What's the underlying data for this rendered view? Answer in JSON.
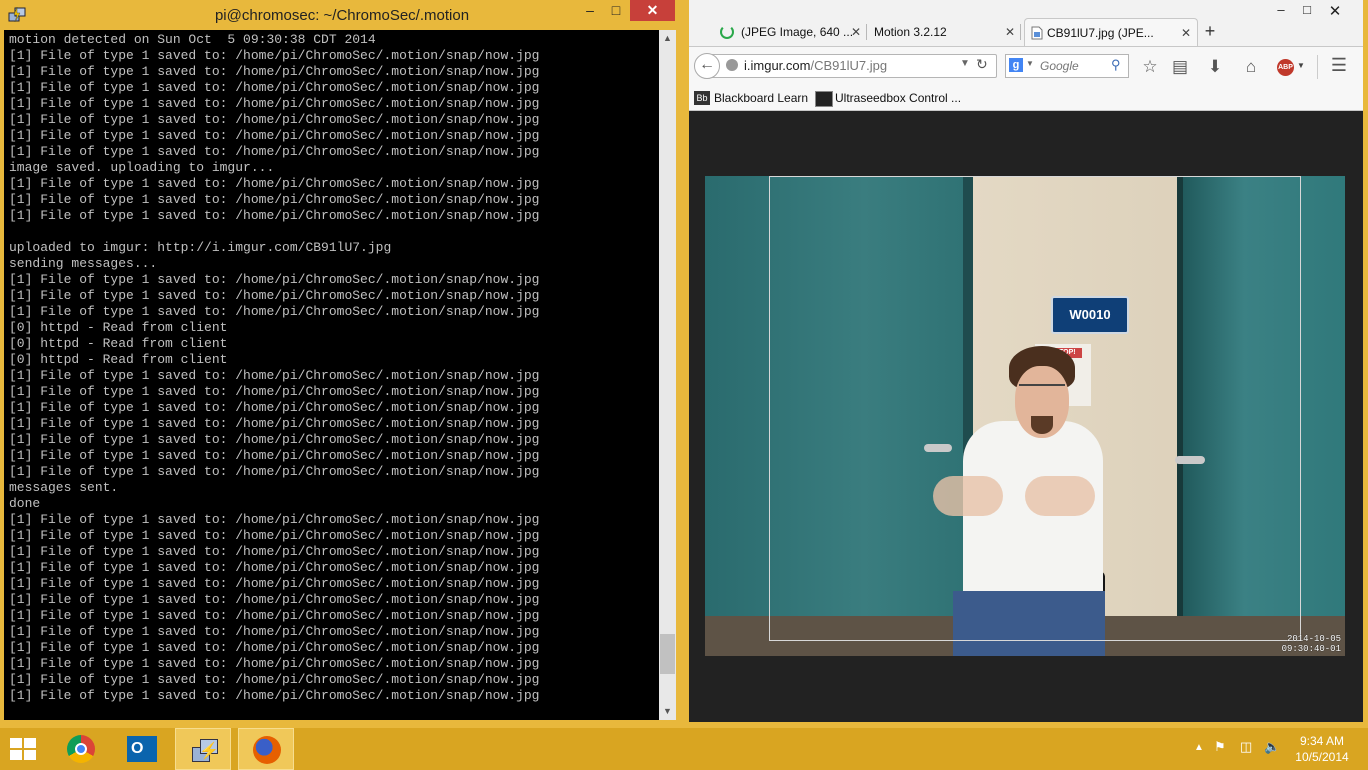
{
  "terminal": {
    "title": "pi@chromosec: ~/ChromoSec/.motion",
    "lines": [
      "motion detected on Sun Oct  5 09:30:38 CDT 2014",
      "[1] File of type 1 saved to: /home/pi/ChromoSec/.motion/snap/now.jpg",
      "[1] File of type 1 saved to: /home/pi/ChromoSec/.motion/snap/now.jpg",
      "[1] File of type 1 saved to: /home/pi/ChromoSec/.motion/snap/now.jpg",
      "[1] File of type 1 saved to: /home/pi/ChromoSec/.motion/snap/now.jpg",
      "[1] File of type 1 saved to: /home/pi/ChromoSec/.motion/snap/now.jpg",
      "[1] File of type 1 saved to: /home/pi/ChromoSec/.motion/snap/now.jpg",
      "[1] File of type 1 saved to: /home/pi/ChromoSec/.motion/snap/now.jpg",
      "image saved. uploading to imgur...",
      "[1] File of type 1 saved to: /home/pi/ChromoSec/.motion/snap/now.jpg",
      "[1] File of type 1 saved to: /home/pi/ChromoSec/.motion/snap/now.jpg",
      "[1] File of type 1 saved to: /home/pi/ChromoSec/.motion/snap/now.jpg",
      "",
      "uploaded to imgur: http://i.imgur.com/CB91lU7.jpg",
      "sending messages...",
      "[1] File of type 1 saved to: /home/pi/ChromoSec/.motion/snap/now.jpg",
      "[1] File of type 1 saved to: /home/pi/ChromoSec/.motion/snap/now.jpg",
      "[1] File of type 1 saved to: /home/pi/ChromoSec/.motion/snap/now.jpg",
      "[0] httpd - Read from client",
      "[0] httpd - Read from client",
      "[0] httpd - Read from client",
      "[1] File of type 1 saved to: /home/pi/ChromoSec/.motion/snap/now.jpg",
      "[1] File of type 1 saved to: /home/pi/ChromoSec/.motion/snap/now.jpg",
      "[1] File of type 1 saved to: /home/pi/ChromoSec/.motion/snap/now.jpg",
      "[1] File of type 1 saved to: /home/pi/ChromoSec/.motion/snap/now.jpg",
      "[1] File of type 1 saved to: /home/pi/ChromoSec/.motion/snap/now.jpg",
      "[1] File of type 1 saved to: /home/pi/ChromoSec/.motion/snap/now.jpg",
      "[1] File of type 1 saved to: /home/pi/ChromoSec/.motion/snap/now.jpg",
      "messages sent.",
      "done",
      "[1] File of type 1 saved to: /home/pi/ChromoSec/.motion/snap/now.jpg",
      "[1] File of type 1 saved to: /home/pi/ChromoSec/.motion/snap/now.jpg",
      "[1] File of type 1 saved to: /home/pi/ChromoSec/.motion/snap/now.jpg",
      "[1] File of type 1 saved to: /home/pi/ChromoSec/.motion/snap/now.jpg",
      "[1] File of type 1 saved to: /home/pi/ChromoSec/.motion/snap/now.jpg",
      "[1] File of type 1 saved to: /home/pi/ChromoSec/.motion/snap/now.jpg",
      "[1] File of type 1 saved to: /home/pi/ChromoSec/.motion/snap/now.jpg",
      "[1] File of type 1 saved to: /home/pi/ChromoSec/.motion/snap/now.jpg",
      "[1] File of type 1 saved to: /home/pi/ChromoSec/.motion/snap/now.jpg",
      "[1] File of type 1 saved to: /home/pi/ChromoSec/.motion/snap/now.jpg",
      "[1] File of type 1 saved to: /home/pi/ChromoSec/.motion/snap/now.jpg",
      "[1] File of type 1 saved to: /home/pi/ChromoSec/.motion/snap/now.jpg"
    ],
    "colors": {
      "background": "#000000",
      "text": "#c0c0c0",
      "frame": "#e8b83c"
    }
  },
  "browser": {
    "tabs": [
      {
        "label": "(JPEG Image, 640 ...",
        "loading": true
      },
      {
        "label": "Motion 3.2.12"
      },
      {
        "label": "CB91lU7.jpg (JPE...",
        "active": true
      }
    ],
    "url_host": "i.imgur.com",
    "url_path": "/CB91lU7.jpg",
    "search_placeholder": "Google",
    "search_engine_letter": "g",
    "bookmarks": [
      "Blackboard Learn",
      "Ultraseedbox Control ..."
    ],
    "bookmark_icon_text": "Bb",
    "adblock_label": "ABP",
    "image": {
      "sign_text": "W0010",
      "poster_text": "STOP!",
      "timestamp_date": "2014-10-05",
      "timestamp_time": "09:30:40-01"
    }
  },
  "taskbar": {
    "apps": [
      "start-icon",
      "chrome-icon",
      "outlook-icon",
      "putty-icon",
      "firefox-icon"
    ],
    "outlook_letter": "O",
    "clock_time": "9:34 AM",
    "clock_date": "10/5/2014",
    "tray_expand": "▲",
    "accent": "#d9a521"
  }
}
